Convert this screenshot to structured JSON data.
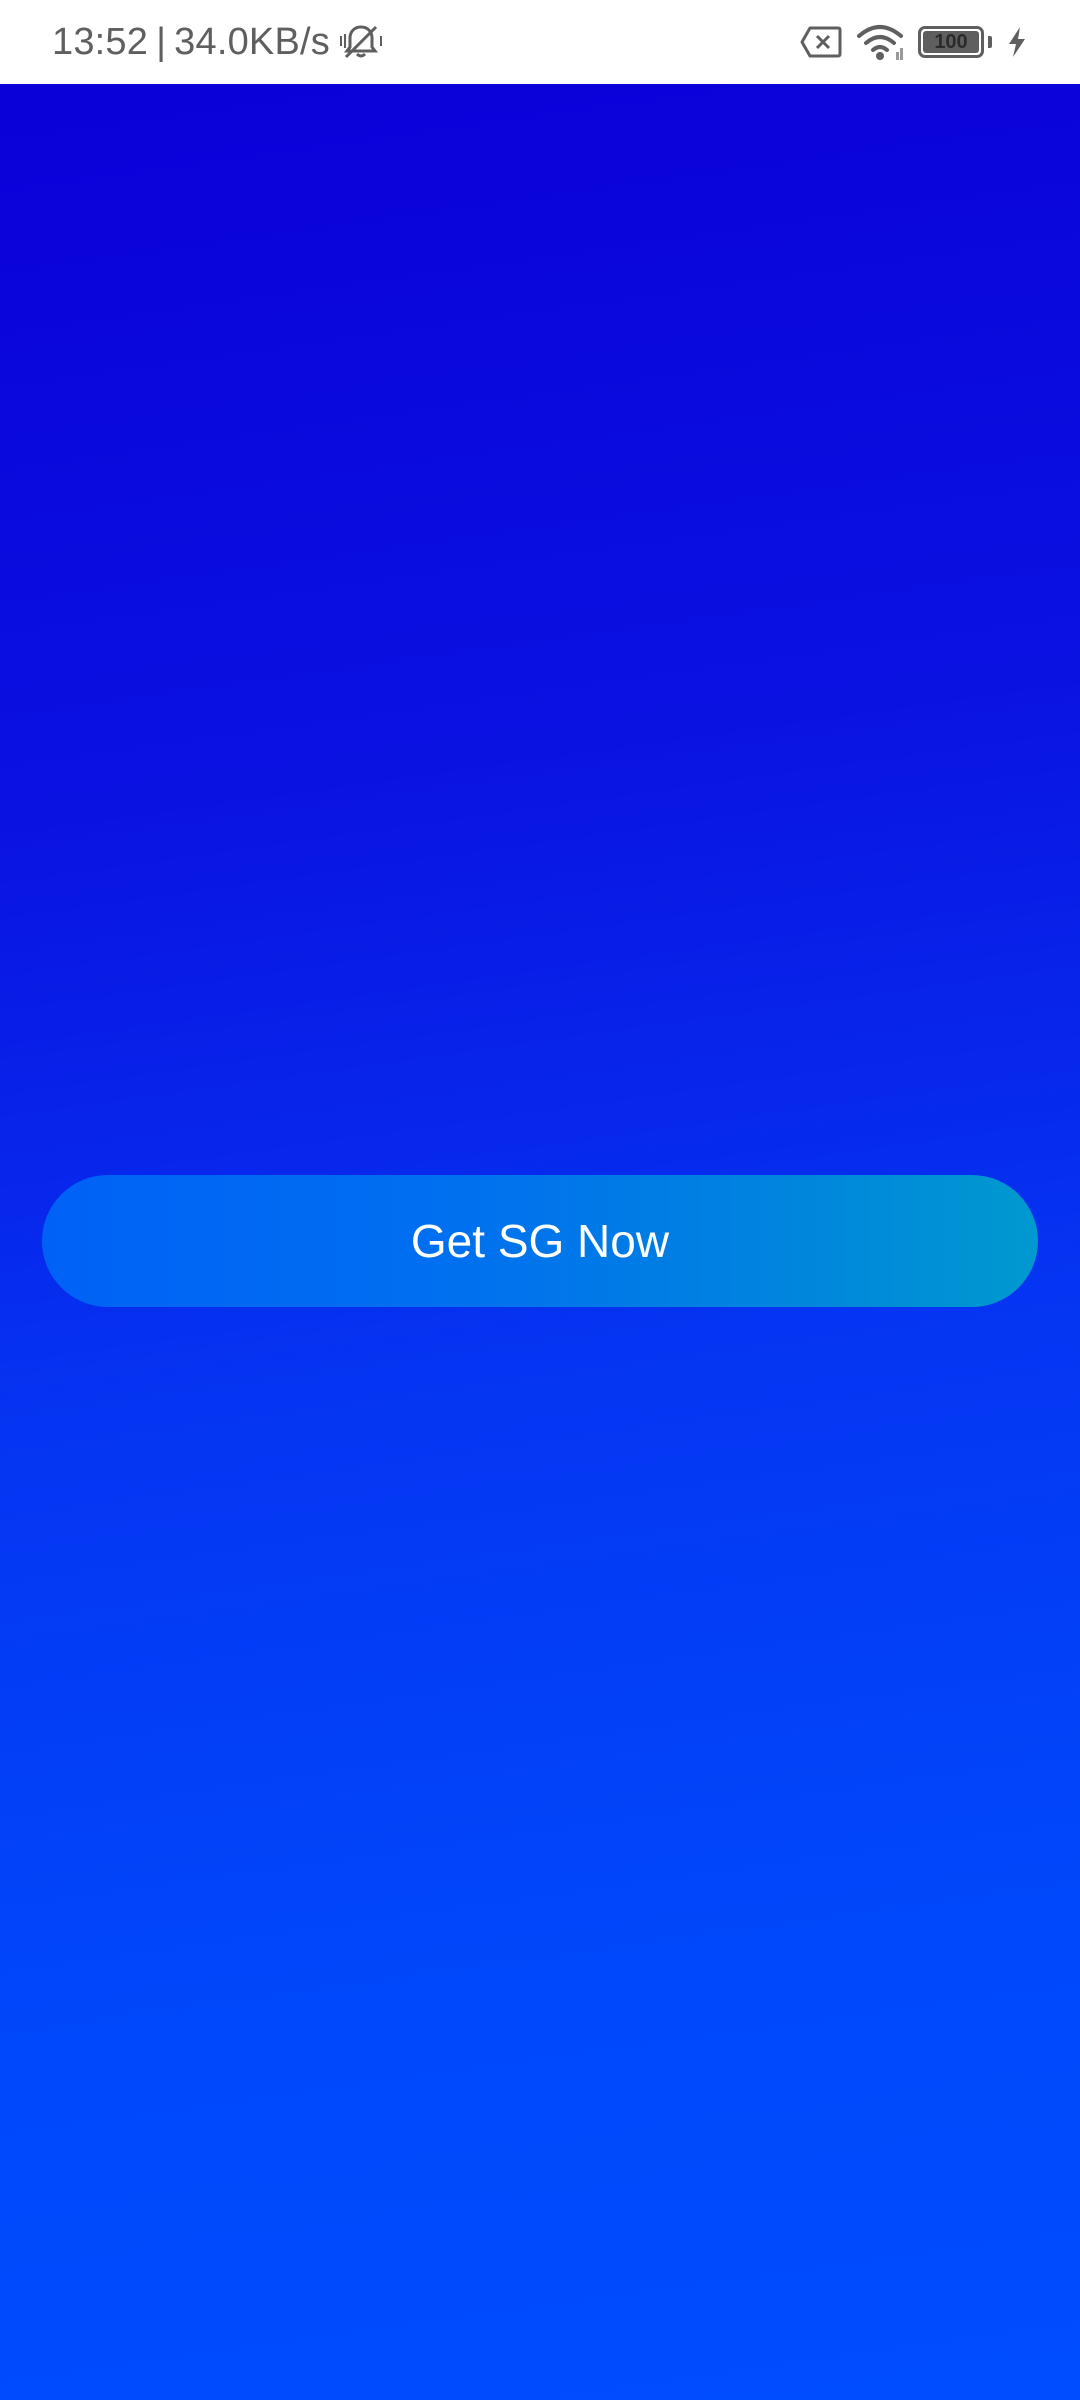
{
  "status_bar": {
    "time": "13:52",
    "separator": "|",
    "network_speed": "34.0KB/s",
    "icons": [
      "bell-muted-icon",
      "sim-none-icon",
      "wifi-icon",
      "battery-icon",
      "charging-bolt-icon"
    ],
    "battery_level": "100"
  },
  "main": {
    "cta_label": "Get SG Now"
  },
  "colors": {
    "background_top": "#0a00d8",
    "background_bottom": "#004cff",
    "button_left": "#0061f6",
    "button_right": "#0099cf",
    "button_text": "#ffffff",
    "status_text": "#5f5f5f"
  }
}
